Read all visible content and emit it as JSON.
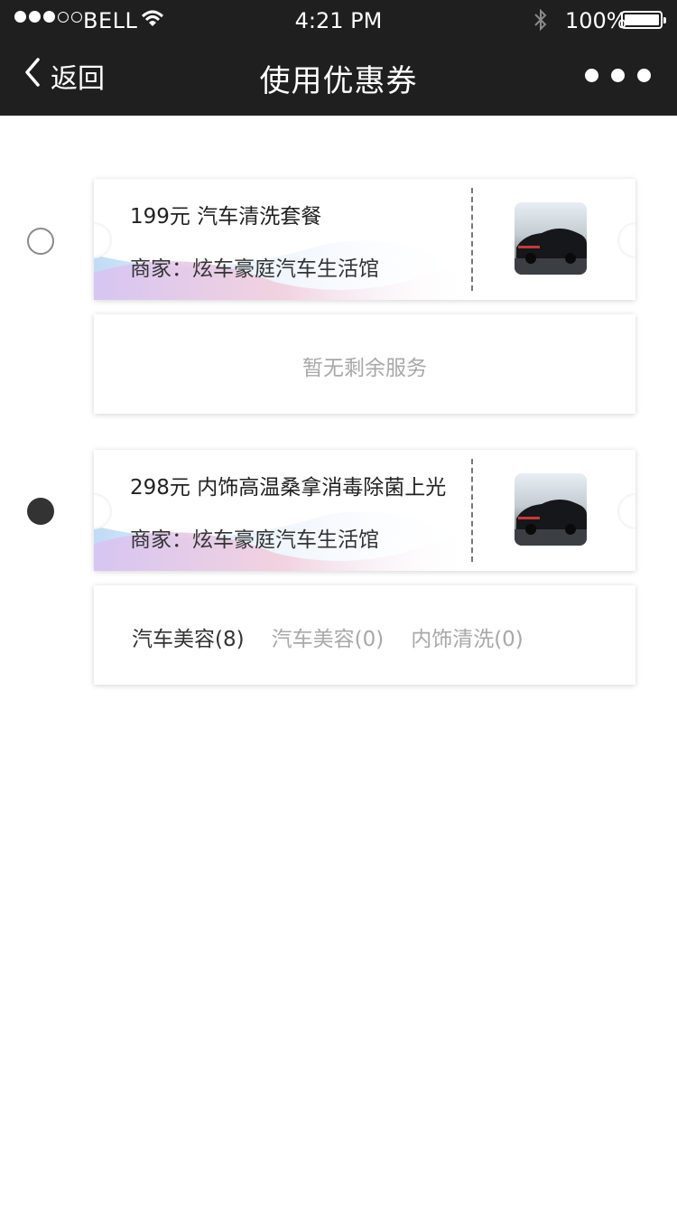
{
  "status_bar": {
    "carrier": "BELL",
    "time": "4:21 PM",
    "battery": "100%",
    "battery_level": 1.0
  },
  "nav": {
    "back_label": "返回",
    "title": "使用优惠券"
  },
  "coupons": [
    {
      "name": "199元 汽车清洗套餐",
      "merchant": "商家：炫车豪庭汽车生活馆",
      "selected": false,
      "service_empty": "暂无剩余服务"
    },
    {
      "name": "298元 内饰高温桑拿消毒除菌上光",
      "merchant": "商家：炫车豪庭汽车生活馆",
      "selected": true,
      "service_tags": [
        "汽车美容(8)",
        "汽车美容(0)",
        "内饰清洗(0)"
      ]
    }
  ],
  "colors": {
    "nav_bg": "#1f1f1f",
    "selected_radio": "#333333",
    "muted_text": "#a8a8a8"
  }
}
